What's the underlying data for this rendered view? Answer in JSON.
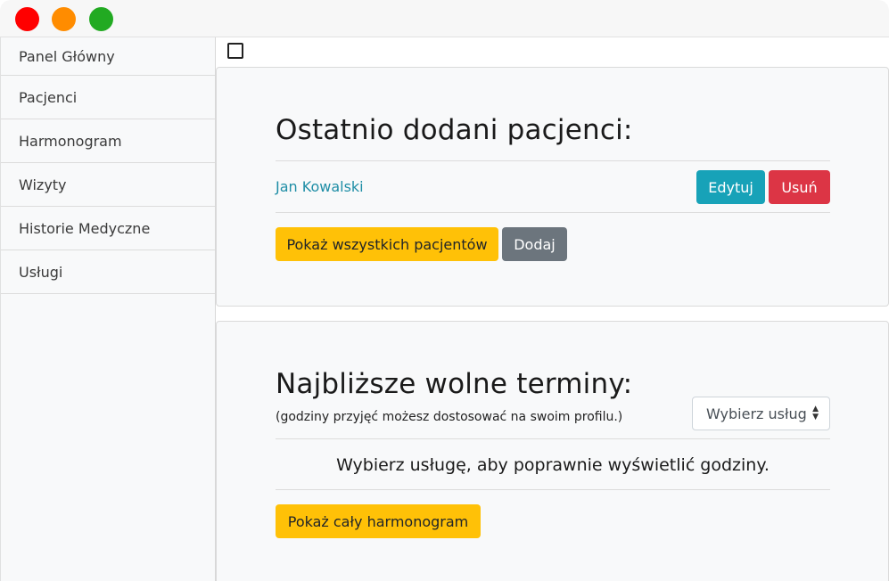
{
  "window": {
    "controls": [
      "close",
      "minimize",
      "maximize"
    ]
  },
  "sidebar": {
    "items": [
      {
        "label": "Panel Główny"
      },
      {
        "label": "Pacjenci"
      },
      {
        "label": "Harmonogram"
      },
      {
        "label": "Wizyty"
      },
      {
        "label": "Historie Medyczne"
      },
      {
        "label": "Usługi"
      }
    ]
  },
  "recent_patients": {
    "title": "Ostatnio dodani pacjenci:",
    "patients": [
      {
        "name": "Jan Kowalski",
        "edit_label": "Edytuj",
        "delete_label": "Usuń"
      }
    ],
    "show_all_label": "Pokaż wszystkich pacjentów",
    "add_label": "Dodaj"
  },
  "free_slots": {
    "title": "Najbliższe wolne terminy:",
    "subtitle": "(godziny przyjęć możesz dostosować na swoim profilu.)",
    "service_select": {
      "selected": "Wybierz usługę"
    },
    "message": "Wybierz usługę, aby poprawnie wyświetlić godziny.",
    "show_schedule_label": "Pokaż cały harmonogram"
  },
  "colors": {
    "info": "#17a2b8",
    "danger": "#dc3545",
    "warning": "#ffc107",
    "secondary": "#6c757d",
    "link": "#1f8ea6"
  }
}
